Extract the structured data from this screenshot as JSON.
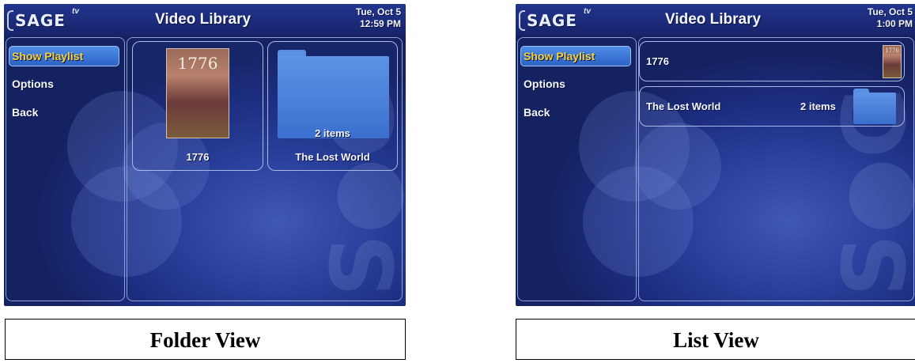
{
  "screens": [
    {
      "logo": "SAGE",
      "logo_tv": "tv",
      "title": "Video Library",
      "date": "Tue, Oct 5",
      "time": "12:59 PM",
      "menu": [
        "Show Playlist",
        "Options",
        "Back"
      ],
      "items": [
        {
          "label": "1776",
          "poster_text": "1776",
          "type": "movie"
        },
        {
          "label": "The Lost World",
          "count": "2 items",
          "type": "folder"
        }
      ],
      "caption": "Folder View"
    },
    {
      "logo": "SAGE",
      "logo_tv": "tv",
      "title": "Video Library",
      "date": "Tue, Oct 5",
      "time": "1:00 PM",
      "menu": [
        "Show Playlist",
        "Options",
        "Back"
      ],
      "items": [
        {
          "label": "1776",
          "poster_text": "1776",
          "type": "movie"
        },
        {
          "label": "The Lost World",
          "count": "2 items",
          "type": "folder"
        }
      ],
      "caption": "List View"
    }
  ],
  "colors": {
    "background": "#1d2e82",
    "selected_menu": "#2b61c4",
    "selected_text": "#f7d13a",
    "folder": "#4a80da"
  }
}
